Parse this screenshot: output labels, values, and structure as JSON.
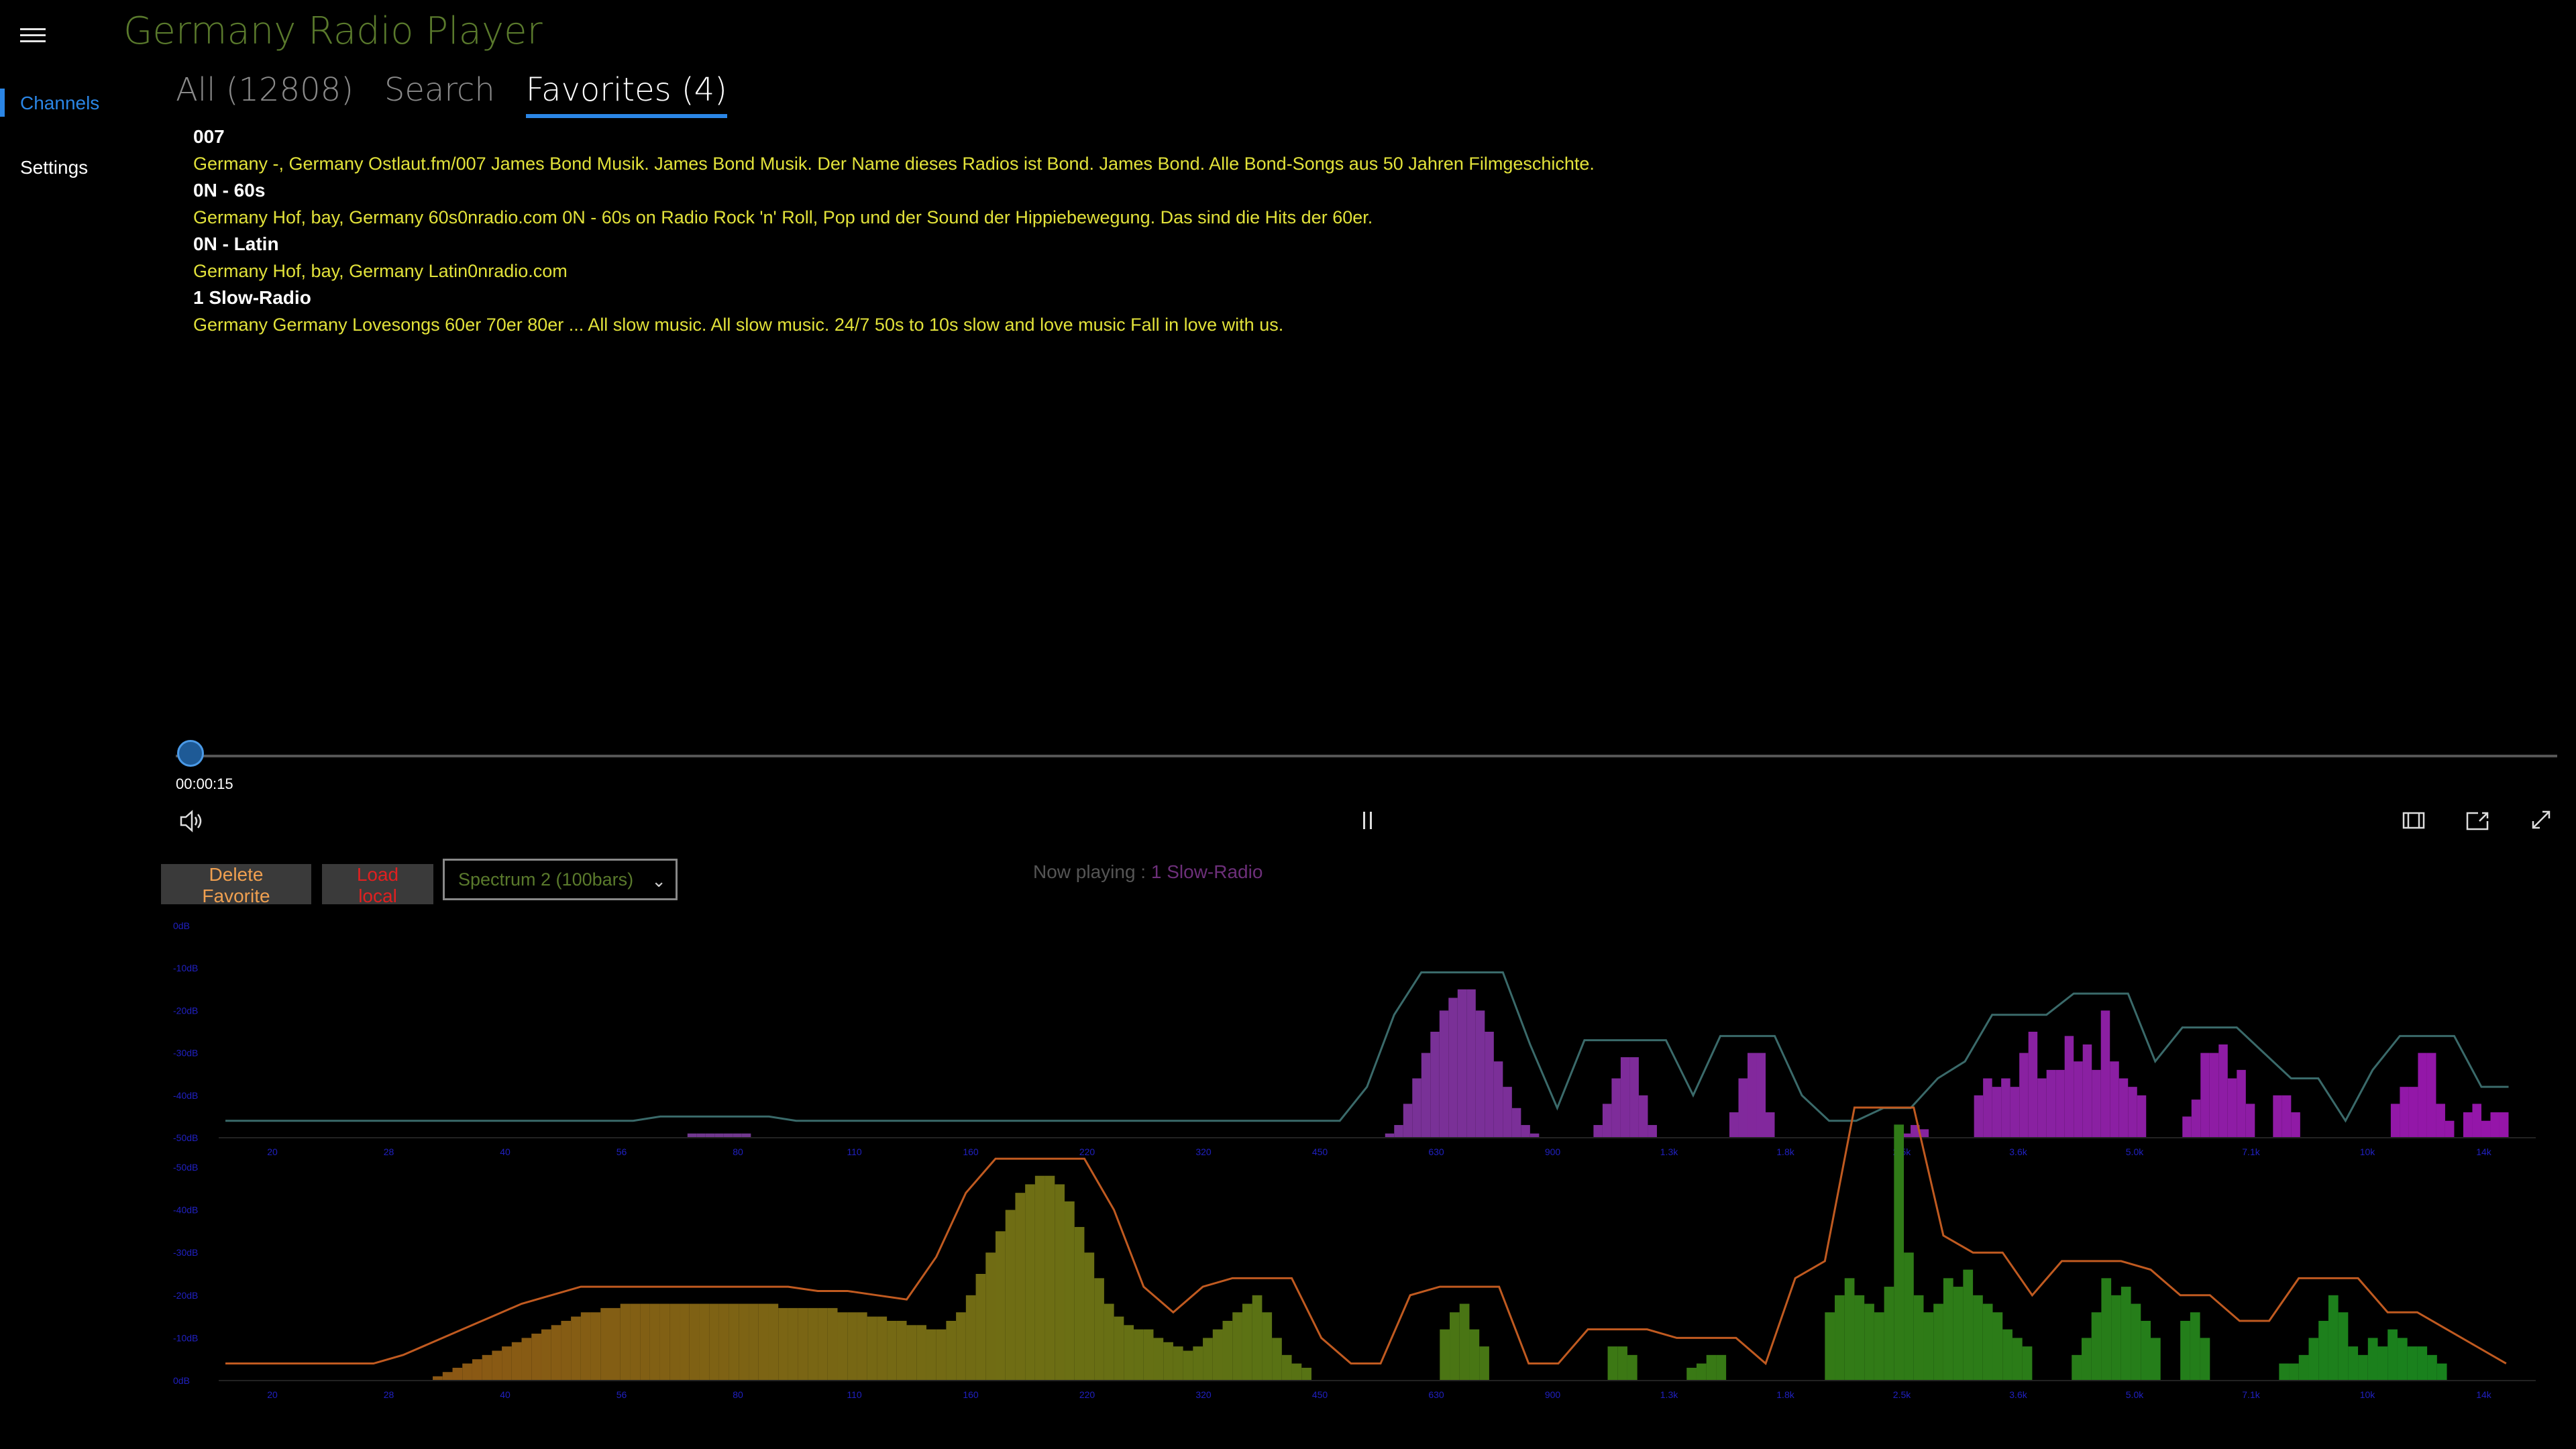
{
  "app": {
    "title": "Germany Radio Player"
  },
  "nav": {
    "channels": "Channels",
    "settings": "Settings"
  },
  "tabs": [
    {
      "label": "All (12808)"
    },
    {
      "label": "Search"
    },
    {
      "label": "Favorites (4)"
    }
  ],
  "channels": [
    {
      "name": "007",
      "desc": "Germany -, Germany Ostlaut.fm/007 James Bond Musik.  James Bond Musik. Der Name dieses Radios ist Bond. James Bond. Alle Bond-Songs aus 50 Jahren Filmgeschichte."
    },
    {
      "name": "0N - 60s",
      "desc": "Germany Hof, bay, Germany 60s0nradio.com 0N - 60s on Radio  Rock 'n' Roll, Pop und der Sound der Hippiebewegung. Das sind die Hits der 60er."
    },
    {
      "name": "0N - Latin",
      "desc": "Germany Hof, bay, Germany Latin0nradio.com"
    },
    {
      "name": "1 Slow-Radio",
      "desc": "Germany Germany Lovesongs 60er 70er 80er  ... All slow music.  All slow music. 24/7 50s to 10s slow and love music Fall in love with us."
    }
  ],
  "player": {
    "time": "00:00:15",
    "progress": 0.0
  },
  "buttons": {
    "delete_favorite": "Delete Favorite",
    "load_local": "Load local"
  },
  "visualizer_select": {
    "value": "Spectrum 2 (100bars)"
  },
  "now_playing": {
    "prefix": "Now playing : ",
    "name": "1 Slow-Radio"
  },
  "colors": {
    "accent": "#2b86e6",
    "title": "#5a7a2c",
    "desc": "#e2e23a",
    "delete_text": "#f0a050",
    "load_text": "#e02020",
    "axis_text": "#2020c0",
    "line_top": "#3a6a6a",
    "line_bottom": "#c05a20"
  },
  "chart_data": {
    "type": "bar",
    "freq_labels": [
      "20",
      "28",
      "40",
      "56",
      "80",
      "110",
      "160",
      "220",
      "320",
      "450",
      "630",
      "900",
      "1.3k",
      "1.8k",
      "2.5k",
      "3.6k",
      "5.0k",
      "7.1k",
      "10k",
      "14k"
    ],
    "top_db_labels": [
      "0dB",
      "-10dB",
      "-20dB",
      "-30dB",
      "-40dB",
      "-50dB"
    ],
    "bottom_db_labels": [
      "-50dB",
      "-40dB",
      "-30dB",
      "-20dB",
      "-10dB",
      "0dB"
    ],
    "top_bars": [
      0,
      0,
      0,
      0,
      0,
      0,
      0,
      0,
      0,
      0,
      0,
      0,
      0,
      0,
      0,
      0,
      0,
      0,
      0,
      0,
      0,
      0,
      0,
      0,
      0,
      0,
      0,
      0,
      0,
      0,
      0,
      0,
      0,
      0,
      0,
      0,
      0,
      0,
      0,
      0,
      0,
      0,
      0,
      0,
      0,
      0,
      0,
      0,
      0,
      0,
      0,
      1,
      1,
      1,
      1,
      1,
      1,
      1,
      0,
      0,
      0,
      0,
      0,
      0,
      0,
      0,
      0,
      0,
      0,
      0,
      0,
      0,
      0,
      0,
      0,
      0,
      0,
      0,
      0,
      0,
      0,
      0,
      0,
      0,
      0,
      0,
      0,
      0,
      0,
      0,
      0,
      0,
      0,
      0,
      0,
      0,
      0,
      0,
      0,
      0,
      0,
      0,
      0,
      0,
      0,
      0,
      0,
      0,
      0,
      0,
      0,
      0,
      0,
      0,
      0,
      0,
      0,
      0,
      0,
      0,
      0,
      0,
      0,
      0,
      0,
      0,
      0,
      0,
      1,
      3,
      8,
      14,
      20,
      25,
      30,
      33,
      35,
      35,
      30,
      25,
      18,
      12,
      7,
      3,
      1,
      0,
      0,
      0,
      0,
      0,
      0,
      3,
      8,
      14,
      19,
      19,
      10,
      3,
      0,
      0,
      0,
      0,
      0,
      0,
      0,
      0,
      6,
      14,
      20,
      20,
      6,
      0,
      0,
      0,
      0,
      0,
      0,
      0,
      0,
      0,
      0,
      0,
      0,
      0,
      0,
      1,
      3,
      2,
      0,
      0,
      0,
      0,
      0,
      10,
      14,
      12,
      14,
      12,
      20,
      25,
      14,
      16,
      16,
      24,
      18,
      22,
      16,
      30,
      18,
      14,
      12,
      10,
      0,
      0,
      0,
      0,
      5,
      9,
      20,
      20,
      22,
      14,
      16,
      8,
      0,
      0,
      10,
      10,
      6,
      0,
      0,
      0,
      0,
      0,
      0,
      0,
      0,
      0,
      0,
      8,
      12,
      12,
      20,
      20,
      8,
      4,
      0,
      6,
      8,
      4,
      6,
      6,
      0,
      0,
      0
    ],
    "bottom_bars": [
      0,
      0,
      0,
      0,
      0,
      0,
      0,
      0,
      0,
      0,
      0,
      0,
      0,
      0,
      0,
      0,
      0,
      0,
      0,
      0,
      0,
      1,
      2,
      3,
      4,
      5,
      6,
      7,
      8,
      9,
      10,
      11,
      12,
      13,
      14,
      15,
      16,
      16,
      17,
      17,
      18,
      18,
      18,
      18,
      18,
      18,
      18,
      18,
      18,
      18,
      18,
      18,
      18,
      18,
      18,
      18,
      17,
      17,
      17,
      17,
      17,
      17,
      16,
      16,
      16,
      15,
      15,
      14,
      14,
      13,
      13,
      12,
      12,
      14,
      16,
      20,
      25,
      30,
      35,
      40,
      44,
      46,
      48,
      48,
      46,
      42,
      36,
      30,
      24,
      18,
      15,
      13,
      12,
      12,
      10,
      9,
      8,
      7,
      8,
      10,
      12,
      14,
      16,
      18,
      20,
      16,
      10,
      6,
      4,
      3,
      0,
      0,
      0,
      0,
      0,
      0,
      0,
      0,
      0,
      0,
      0,
      0,
      0,
      12,
      16,
      18,
      12,
      8,
      0,
      0,
      0,
      0,
      0,
      0,
      0,
      0,
      0,
      0,
      0,
      0,
      8,
      8,
      6,
      0,
      0,
      0,
      0,
      0,
      3,
      4,
      6,
      6,
      0,
      0,
      0,
      0,
      0,
      0,
      0,
      0,
      0,
      0,
      16,
      20,
      24,
      20,
      18,
      16,
      22,
      60,
      30,
      20,
      16,
      18,
      24,
      22,
      26,
      20,
      18,
      16,
      12,
      10,
      8,
      0,
      0,
      0,
      0,
      6,
      10,
      16,
      24,
      20,
      22,
      18,
      14,
      10,
      0,
      0,
      14,
      16,
      10,
      0,
      0,
      0,
      0,
      0,
      0,
      0,
      4,
      4,
      6,
      10,
      14,
      20,
      16,
      8,
      6,
      10,
      8,
      12,
      10,
      8,
      8,
      6,
      4,
      0,
      0,
      0,
      0,
      0,
      0,
      0,
      0,
      0
    ]
  }
}
